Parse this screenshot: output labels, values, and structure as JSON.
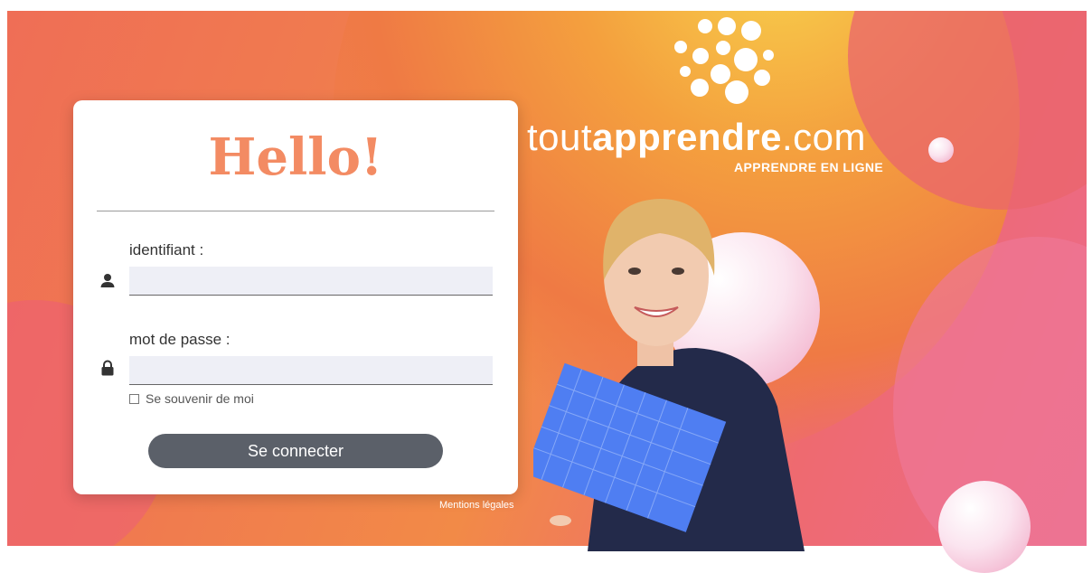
{
  "brand": {
    "name_light_start": "tout",
    "name_bold": "apprendre",
    "name_light_end": ".com",
    "tagline": "APPRENDRE EN LIGNE"
  },
  "login": {
    "title": "Hello!",
    "username_label": "identifiant :",
    "username_value": "",
    "password_label": "mot de passe :",
    "password_value": "",
    "remember_label": "Se souvenir de moi",
    "remember_checked": false,
    "submit_label": "Se connecter"
  },
  "footer": {
    "legal_link": "Mentions légales"
  },
  "icons": {
    "username": "user-icon",
    "password": "lock-icon"
  },
  "colors": {
    "accent_title": "#f38b63",
    "button_bg": "#5b6069",
    "input_bg": "#eeeff6"
  }
}
